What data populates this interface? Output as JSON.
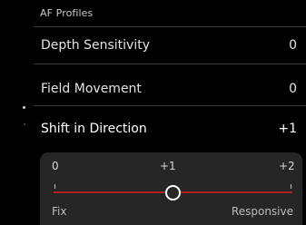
{
  "header": {
    "title": "AF Profiles"
  },
  "menu": {
    "items": [
      {
        "label": "Depth Sensitivity",
        "value": "0"
      },
      {
        "label": "Field Movement",
        "value": "0"
      },
      {
        "label": "Shift in Direction",
        "value": "+1"
      }
    ]
  },
  "slider": {
    "ticks": [
      "0",
      "+1",
      "+2"
    ],
    "min_label": "Fix",
    "max_label": "Responsive",
    "current": "+1",
    "current_fraction": 0.5
  },
  "colors": {
    "background": "#000000",
    "panel": "#262626",
    "track": "#b41f22",
    "thumb_ring": "#ffffff"
  }
}
